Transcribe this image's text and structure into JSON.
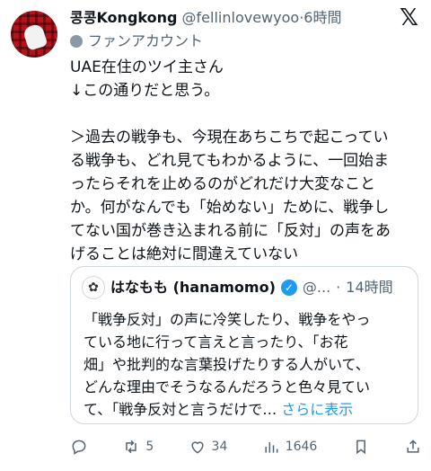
{
  "tweet": {
    "display_name": "콩콩Kongkong",
    "handle": "@fellinlovewyoo",
    "separator": "·",
    "time": "6時間",
    "fan_label": "ファンアカウント",
    "text": "UAE在住のツイ主さん\n↓この通りだと思う。\n\n＞過去の戦争も、今現在あちこちで起こってい\nる戦争も、どれ見てもわかるように、一回始ま\nったらそれを止めるのがどれだけ大変なこと\nか。何がなんでも「始めない」ために、戦争し\nてない国が巻き込まれる前に「反対」の声をあ\nげることは絶対に間違えていない"
  },
  "quote": {
    "name": "はなもも (hanamomo)",
    "handle": "@...",
    "separator": "·",
    "time": "14時間",
    "text": "「戦争反対」の声に冷笑したり、戦争をやっ\nている地に行って言えと言ったり、「お花\n畑」や批判的な言葉投げたりする人がいて、\nどんな理由でそうなるんだろうと色々見てい\nて、「戦争反対と言うだけで…",
    "show_more": "さらに表示"
  },
  "actions": {
    "reply_icon": "reply-icon",
    "retweets": "5",
    "likes": "34",
    "views": "1646"
  },
  "logo": "𝕏"
}
